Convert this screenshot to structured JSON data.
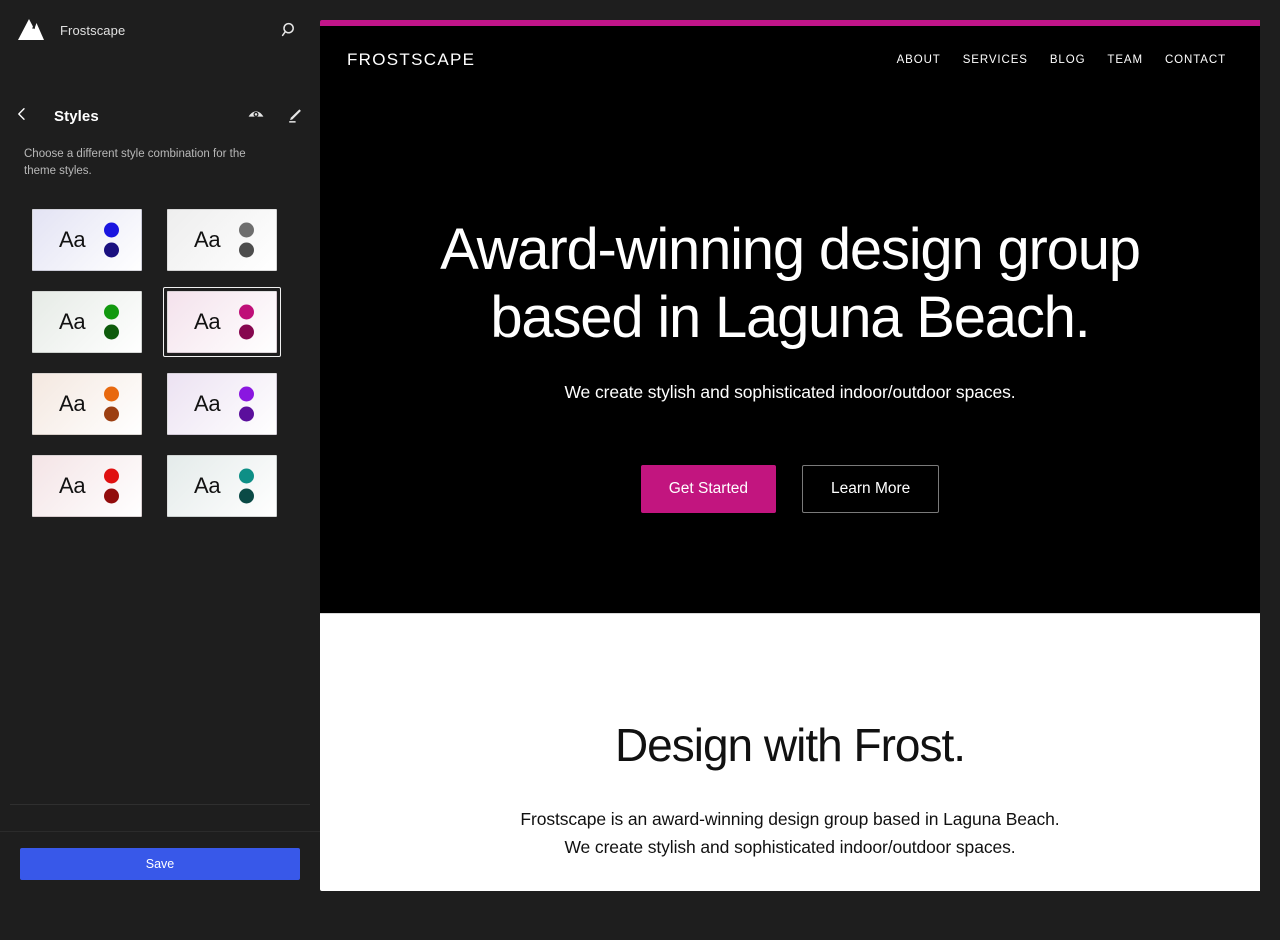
{
  "app": {
    "site_title": "Frostscape",
    "logo_icon": "mountain-icon",
    "search_icon": "search-icon"
  },
  "panel": {
    "back_icon": "chevron-left-icon",
    "title": "Styles",
    "description": "Choose a different style combination for the theme styles.",
    "actions": [
      {
        "icon": "eye-icon",
        "name": "style-book-button"
      },
      {
        "icon": "pencil-icon",
        "name": "edit-styles-button"
      }
    ],
    "variations": [
      {
        "label": "Aa",
        "bg": "#e3e3f4",
        "text": "#121212",
        "dot1": "#1a15e0",
        "dot2": "#1a1080",
        "selected": false
      },
      {
        "label": "Aa",
        "bg": "#eeeeee",
        "text": "#121212",
        "dot1": "#6e6e6e",
        "dot2": "#4d4d4d",
        "selected": false
      },
      {
        "label": "Aa",
        "bg": "#e6ebe6",
        "text": "#121212",
        "dot1": "#12990f",
        "dot2": "#0e5b0c",
        "selected": false
      },
      {
        "label": "Aa",
        "bg": "#f4e2ec",
        "text": "#121212",
        "dot1": "#bf0f78",
        "dot2": "#86074f",
        "selected": true
      },
      {
        "label": "Aa",
        "bg": "#f4e8e0",
        "text": "#121212",
        "dot1": "#e8690f",
        "dot2": "#9c3f12",
        "selected": false
      },
      {
        "label": "Aa",
        "bg": "#ece2f2",
        "text": "#121212",
        "dot1": "#8a17e0",
        "dot2": "#5b0f9c",
        "selected": false
      },
      {
        "label": "Aa",
        "bg": "#f4e4e6",
        "text": "#121212",
        "dot1": "#e01111",
        "dot2": "#920c0c",
        "selected": false
      },
      {
        "label": "Aa",
        "bg": "#e4ebea",
        "text": "#121212",
        "dot1": "#0e8f86",
        "dot2": "#0b4a46",
        "selected": false
      }
    ],
    "save_label": "Save",
    "save_color": "#3858e9"
  },
  "preview": {
    "accent_color": "#c2158a",
    "brand": "FROSTSCAPE",
    "nav": [
      {
        "label": "ABOUT"
      },
      {
        "label": "SERVICES"
      },
      {
        "label": "BLOG"
      },
      {
        "label": "TEAM"
      },
      {
        "label": "CONTACT"
      }
    ],
    "hero": {
      "heading": "Award-winning design group based in Laguna Beach.",
      "subheading": "We create stylish and sophisticated indoor/outdoor spaces.",
      "primary_button": "Get Started",
      "secondary_button": "Learn More",
      "primary_button_color": "#c2157f"
    },
    "light_section": {
      "heading": "Design with Frost.",
      "line1": "Frostscape is an award-winning design group based in Laguna Beach.",
      "line2": "We create stylish and sophisticated indoor/outdoor spaces."
    }
  }
}
